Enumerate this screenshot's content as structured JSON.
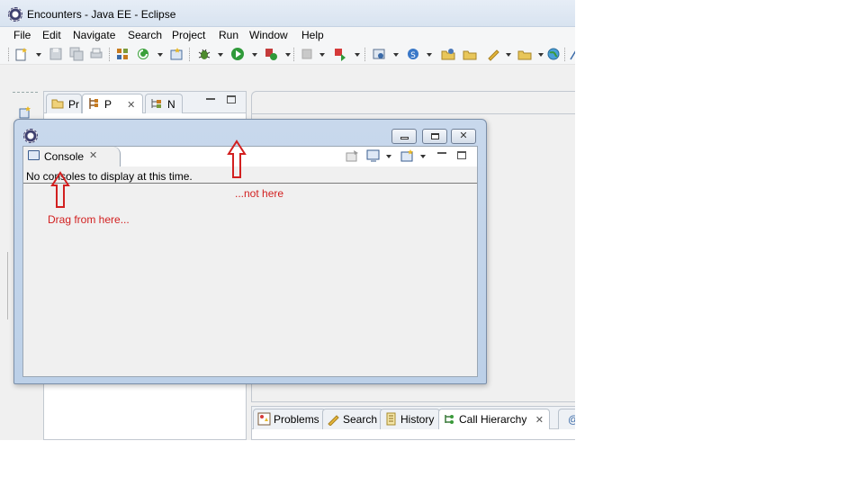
{
  "window": {
    "title": "Encounters - Java EE - Eclipse"
  },
  "menu": [
    "File",
    "Edit",
    "Navigate",
    "Search",
    "Project",
    "Run",
    "Window",
    "Help"
  ],
  "left_tabs": [
    {
      "label": "Pr",
      "icon": "package-explorer-icon"
    },
    {
      "label": "P",
      "icon": "project-explorer-icon"
    },
    {
      "label": "N",
      "icon": "navigator-icon"
    }
  ],
  "bottom_tabs": [
    {
      "label": "Problems",
      "icon": "problems-icon"
    },
    {
      "label": "Search",
      "icon": "search-icon"
    },
    {
      "label": "History",
      "icon": "history-icon"
    },
    {
      "label": "Call Hierarchy",
      "icon": "call-hierarchy-icon"
    },
    {
      "label": "@",
      "icon": "javadoc-icon"
    }
  ],
  "console": {
    "tab_label": "Console",
    "message": "No consoles to display at this time."
  },
  "annotations": {
    "drag_from": "Drag from here...",
    "not_here": "...not here"
  },
  "colors": {
    "annotation": "#d22020",
    "title_bar": "#d8e3f0"
  }
}
